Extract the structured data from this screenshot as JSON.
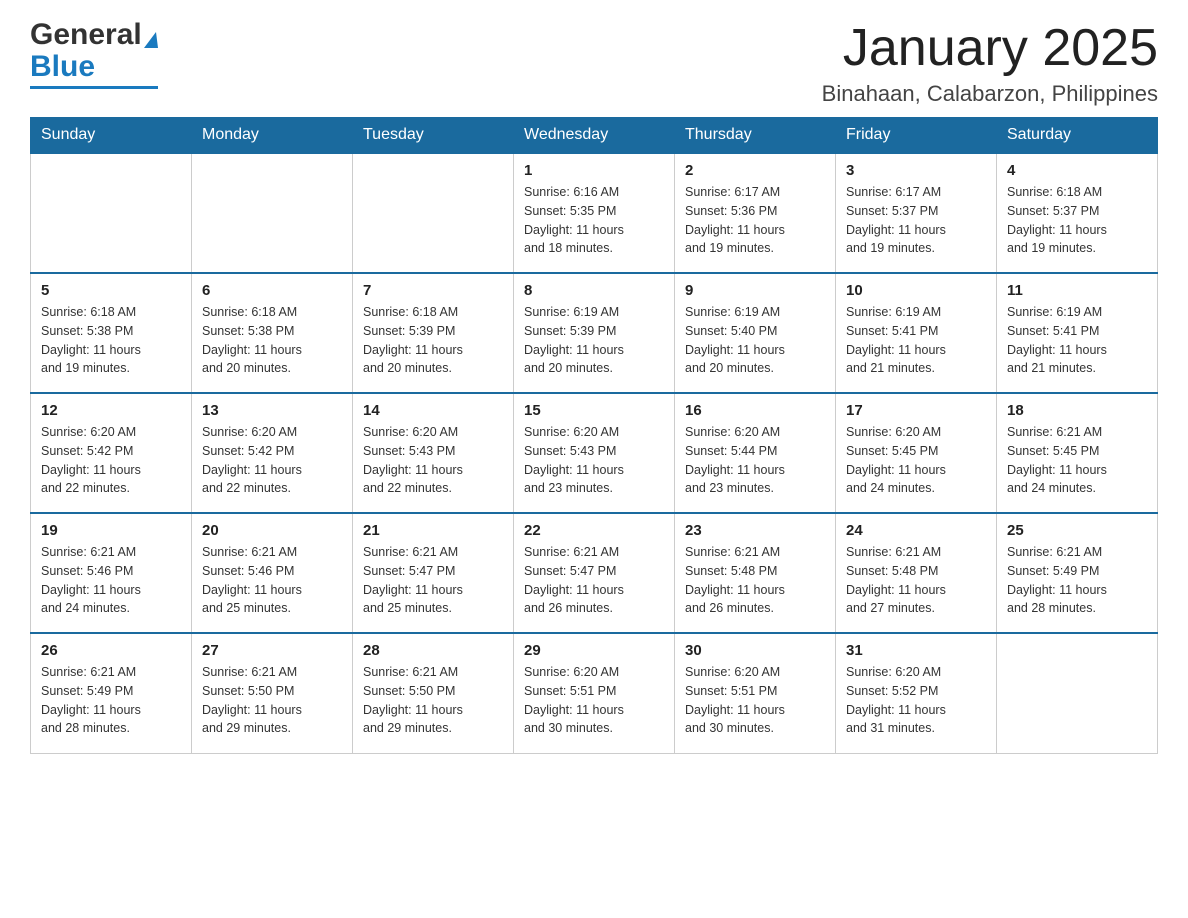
{
  "header": {
    "logo_general": "General",
    "logo_blue": "Blue",
    "month_title": "January 2025",
    "location": "Binahaan, Calabarzon, Philippines"
  },
  "days_of_week": [
    "Sunday",
    "Monday",
    "Tuesday",
    "Wednesday",
    "Thursday",
    "Friday",
    "Saturday"
  ],
  "weeks": [
    [
      {
        "day": "",
        "info": ""
      },
      {
        "day": "",
        "info": ""
      },
      {
        "day": "",
        "info": ""
      },
      {
        "day": "1",
        "info": "Sunrise: 6:16 AM\nSunset: 5:35 PM\nDaylight: 11 hours\nand 18 minutes."
      },
      {
        "day": "2",
        "info": "Sunrise: 6:17 AM\nSunset: 5:36 PM\nDaylight: 11 hours\nand 19 minutes."
      },
      {
        "day": "3",
        "info": "Sunrise: 6:17 AM\nSunset: 5:37 PM\nDaylight: 11 hours\nand 19 minutes."
      },
      {
        "day": "4",
        "info": "Sunrise: 6:18 AM\nSunset: 5:37 PM\nDaylight: 11 hours\nand 19 minutes."
      }
    ],
    [
      {
        "day": "5",
        "info": "Sunrise: 6:18 AM\nSunset: 5:38 PM\nDaylight: 11 hours\nand 19 minutes."
      },
      {
        "day": "6",
        "info": "Sunrise: 6:18 AM\nSunset: 5:38 PM\nDaylight: 11 hours\nand 20 minutes."
      },
      {
        "day": "7",
        "info": "Sunrise: 6:18 AM\nSunset: 5:39 PM\nDaylight: 11 hours\nand 20 minutes."
      },
      {
        "day": "8",
        "info": "Sunrise: 6:19 AM\nSunset: 5:39 PM\nDaylight: 11 hours\nand 20 minutes."
      },
      {
        "day": "9",
        "info": "Sunrise: 6:19 AM\nSunset: 5:40 PM\nDaylight: 11 hours\nand 20 minutes."
      },
      {
        "day": "10",
        "info": "Sunrise: 6:19 AM\nSunset: 5:41 PM\nDaylight: 11 hours\nand 21 minutes."
      },
      {
        "day": "11",
        "info": "Sunrise: 6:19 AM\nSunset: 5:41 PM\nDaylight: 11 hours\nand 21 minutes."
      }
    ],
    [
      {
        "day": "12",
        "info": "Sunrise: 6:20 AM\nSunset: 5:42 PM\nDaylight: 11 hours\nand 22 minutes."
      },
      {
        "day": "13",
        "info": "Sunrise: 6:20 AM\nSunset: 5:42 PM\nDaylight: 11 hours\nand 22 minutes."
      },
      {
        "day": "14",
        "info": "Sunrise: 6:20 AM\nSunset: 5:43 PM\nDaylight: 11 hours\nand 22 minutes."
      },
      {
        "day": "15",
        "info": "Sunrise: 6:20 AM\nSunset: 5:43 PM\nDaylight: 11 hours\nand 23 minutes."
      },
      {
        "day": "16",
        "info": "Sunrise: 6:20 AM\nSunset: 5:44 PM\nDaylight: 11 hours\nand 23 minutes."
      },
      {
        "day": "17",
        "info": "Sunrise: 6:20 AM\nSunset: 5:45 PM\nDaylight: 11 hours\nand 24 minutes."
      },
      {
        "day": "18",
        "info": "Sunrise: 6:21 AM\nSunset: 5:45 PM\nDaylight: 11 hours\nand 24 minutes."
      }
    ],
    [
      {
        "day": "19",
        "info": "Sunrise: 6:21 AM\nSunset: 5:46 PM\nDaylight: 11 hours\nand 24 minutes."
      },
      {
        "day": "20",
        "info": "Sunrise: 6:21 AM\nSunset: 5:46 PM\nDaylight: 11 hours\nand 25 minutes."
      },
      {
        "day": "21",
        "info": "Sunrise: 6:21 AM\nSunset: 5:47 PM\nDaylight: 11 hours\nand 25 minutes."
      },
      {
        "day": "22",
        "info": "Sunrise: 6:21 AM\nSunset: 5:47 PM\nDaylight: 11 hours\nand 26 minutes."
      },
      {
        "day": "23",
        "info": "Sunrise: 6:21 AM\nSunset: 5:48 PM\nDaylight: 11 hours\nand 26 minutes."
      },
      {
        "day": "24",
        "info": "Sunrise: 6:21 AM\nSunset: 5:48 PM\nDaylight: 11 hours\nand 27 minutes."
      },
      {
        "day": "25",
        "info": "Sunrise: 6:21 AM\nSunset: 5:49 PM\nDaylight: 11 hours\nand 28 minutes."
      }
    ],
    [
      {
        "day": "26",
        "info": "Sunrise: 6:21 AM\nSunset: 5:49 PM\nDaylight: 11 hours\nand 28 minutes."
      },
      {
        "day": "27",
        "info": "Sunrise: 6:21 AM\nSunset: 5:50 PM\nDaylight: 11 hours\nand 29 minutes."
      },
      {
        "day": "28",
        "info": "Sunrise: 6:21 AM\nSunset: 5:50 PM\nDaylight: 11 hours\nand 29 minutes."
      },
      {
        "day": "29",
        "info": "Sunrise: 6:20 AM\nSunset: 5:51 PM\nDaylight: 11 hours\nand 30 minutes."
      },
      {
        "day": "30",
        "info": "Sunrise: 6:20 AM\nSunset: 5:51 PM\nDaylight: 11 hours\nand 30 minutes."
      },
      {
        "day": "31",
        "info": "Sunrise: 6:20 AM\nSunset: 5:52 PM\nDaylight: 11 hours\nand 31 minutes."
      },
      {
        "day": "",
        "info": ""
      }
    ]
  ]
}
